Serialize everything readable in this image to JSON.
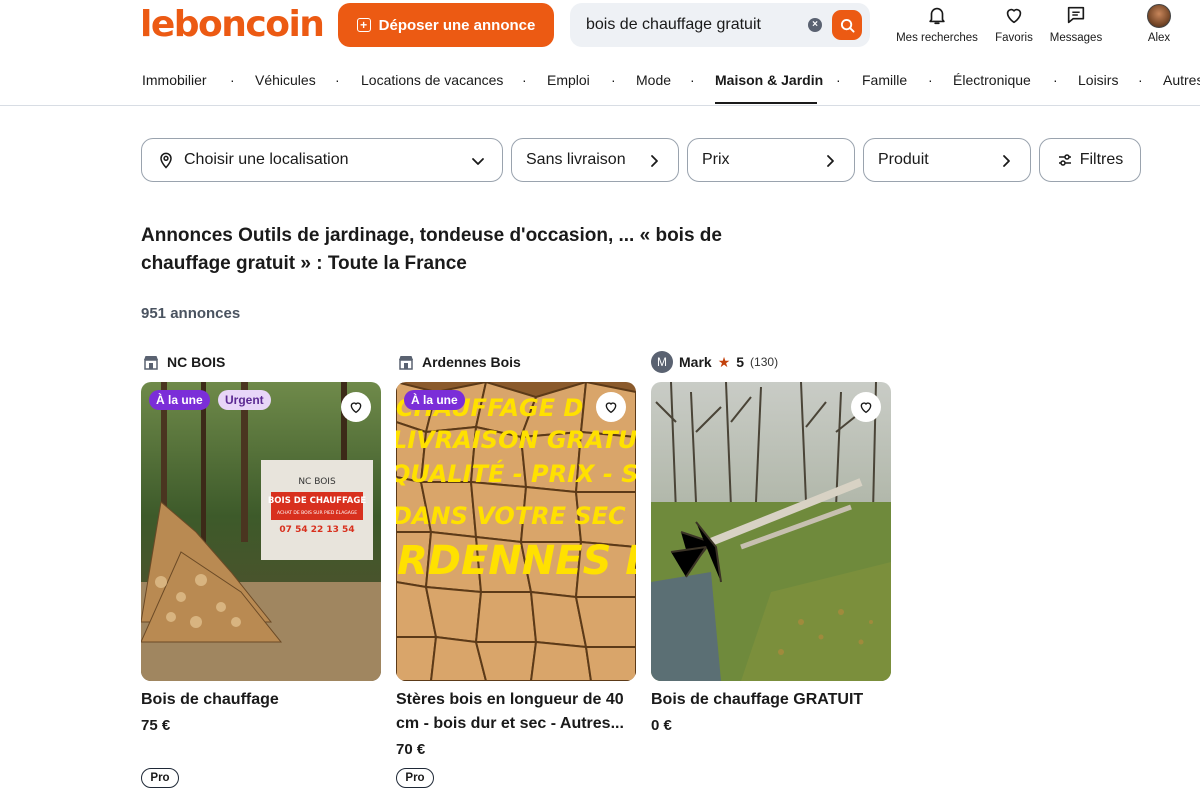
{
  "header": {
    "logo": "leboncoin",
    "post_button": "Déposer une annonce",
    "search_value": "bois de chauffage gratuit",
    "nav": [
      {
        "label": "Mes recherches",
        "icon": "bell-icon"
      },
      {
        "label": "Favoris",
        "icon": "heart-icon"
      },
      {
        "label": "Messages",
        "icon": "message-icon"
      },
      {
        "label": "Alex",
        "icon": "avatar"
      }
    ]
  },
  "categories": [
    "Immobilier",
    "Véhicules",
    "Locations de vacances",
    "Emploi",
    "Mode",
    "Maison & Jardin",
    "Famille",
    "Électronique",
    "Loisirs",
    "Autres"
  ],
  "active_category": "Maison & Jardin",
  "filters": {
    "location": "Choisir une localisation",
    "delivery": "Sans livraison",
    "price": "Prix",
    "product": "Produit",
    "more": "Filtres"
  },
  "results": {
    "title": "Annonces Outils de jardinage, tondeuse d'occasion, ... « bois de chauffage gratuit » : Toute la France",
    "count": "951 annonces"
  },
  "listings": [
    {
      "seller": "NC BOIS",
      "seller_type": "store",
      "badges": [
        "À la une",
        "Urgent"
      ],
      "title": "Bois de chauffage",
      "price": "75 €",
      "pro": "Pro",
      "image_text": [
        "NC BOIS",
        "BOIS DE CHAUFFAGE",
        "ACHAT DE BOIS SUR PIED ÉLAGAGE",
        "07 54 22 13 54"
      ]
    },
    {
      "seller": "Ardennes Bois",
      "seller_type": "store",
      "badges": [
        "À la une"
      ],
      "title": "Stères bois en longueur de 40 cm - bois dur et sec - Autres...",
      "price": "70 €",
      "pro": "Pro",
      "image_text": [
        "CHAUFFAGE D",
        "LIVRAISON GRATUIT",
        "QUALITÉ - PRIX - SERVI",
        "DANS VOTRE SEC",
        "ARDENNES B"
      ]
    },
    {
      "seller": "Mark",
      "seller_initial": "M",
      "seller_type": "user",
      "rating": "5",
      "reviews": "(130)",
      "badges": [],
      "title": "Bois de chauffage GRATUIT",
      "price": "0 €"
    }
  ],
  "colors": {
    "brand": "#ec5a13",
    "badge_purple": "#7b2ed8",
    "badge_urgent_bg": "#e8d6f8"
  }
}
